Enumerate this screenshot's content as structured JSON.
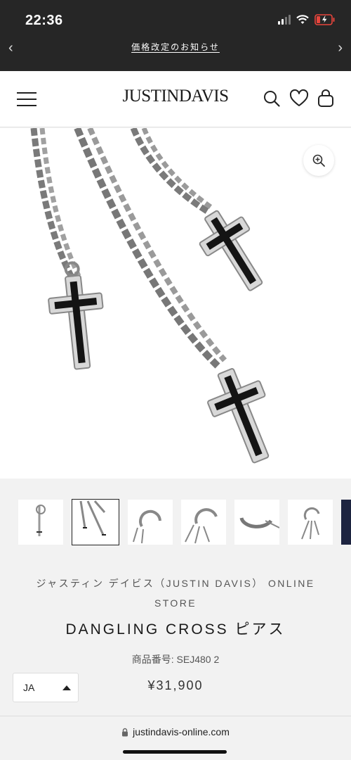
{
  "status_bar": {
    "time": "22:36"
  },
  "announcement": {
    "text": "価格改定のお知らせ"
  },
  "header": {
    "logo": "JUSTINDAVIS"
  },
  "product": {
    "vendor": "ジャスティン デイビス（JUSTIN DAVIS） ONLINE STORE",
    "title": "DANGLING CROSS ピアス",
    "sku": "商品番号: SEJ480 2",
    "price": "¥31,900"
  },
  "language_select": {
    "value": "JA"
  },
  "browser": {
    "url": "justindavis-online.com"
  },
  "icons": {
    "menu": "hamburger-icon",
    "search": "search-icon",
    "wishlist": "heart-icon",
    "cart": "bag-icon",
    "zoom": "zoom-in-icon",
    "lock": "lock-icon",
    "prev": "chevron-left-icon",
    "next": "chevron-right-icon"
  },
  "colors": {
    "top_bar": "#262626",
    "background": "#f2f2f2",
    "text": "#222222"
  }
}
